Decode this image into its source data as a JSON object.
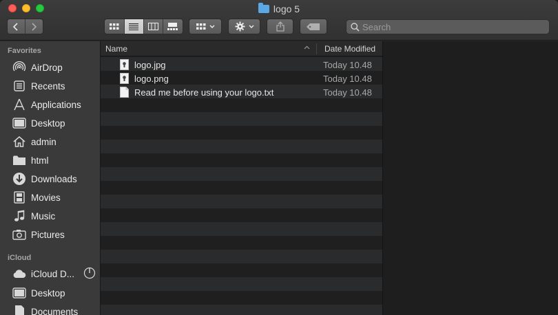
{
  "window": {
    "title": "logo 5"
  },
  "toolbar": {
    "back": "back",
    "forward": "forward",
    "share": "share",
    "tag": "tag",
    "search_placeholder": "Search"
  },
  "sidebar": {
    "favorites_header": "Favorites",
    "favorites": [
      {
        "label": "AirDrop",
        "icon": "airdrop-icon"
      },
      {
        "label": "Recents",
        "icon": "recents-icon"
      },
      {
        "label": "Applications",
        "icon": "applications-icon"
      },
      {
        "label": "Desktop",
        "icon": "desktop-icon"
      },
      {
        "label": "admin",
        "icon": "home-icon"
      },
      {
        "label": "html",
        "icon": "folder-icon"
      },
      {
        "label": "Downloads",
        "icon": "downloads-icon"
      },
      {
        "label": "Movies",
        "icon": "movies-icon"
      },
      {
        "label": "Music",
        "icon": "music-icon"
      },
      {
        "label": "Pictures",
        "icon": "pictures-icon"
      }
    ],
    "icloud_header": "iCloud",
    "icloud": [
      {
        "label": "iCloud D...",
        "icon": "icloud-icon"
      },
      {
        "label": "Desktop",
        "icon": "desktop-icon"
      },
      {
        "label": "Documents",
        "icon": "documents-icon"
      }
    ]
  },
  "list": {
    "columns": {
      "name": "Name",
      "date": "Date Modified"
    },
    "files": [
      {
        "name": "logo.jpg",
        "date": "Today 10.48",
        "icon": "image-file-icon"
      },
      {
        "name": "logo.png",
        "date": "Today 10.48",
        "icon": "image-file-icon"
      },
      {
        "name": "Read me before using your logo.txt",
        "date": "Today 10.48",
        "icon": "text-file-icon"
      }
    ]
  }
}
